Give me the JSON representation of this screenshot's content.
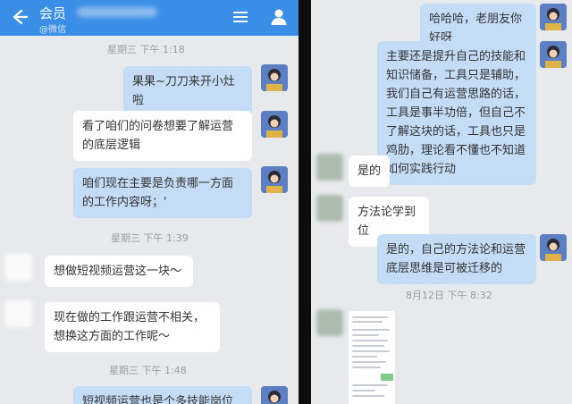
{
  "left": {
    "header": {
      "title": "会员",
      "subtitle": "@微信"
    },
    "messages": [
      {
        "timestamp": "星期三  下午 1:18"
      },
      {
        "text": "果果~刀刀来开小灶啦"
      },
      {
        "text": "看了咱们的问卷想要了解运营的底层逻辑"
      },
      {
        "text": "咱们现在主要是负责哪一方面的工作内容呀；'"
      },
      {
        "timestamp": "星期三  下午 1:39"
      },
      {
        "text": "想做短视频运营这一块～"
      },
      {
        "text": "现在做的工作跟运营不相关，想换这方面的工作呢～"
      },
      {
        "timestamp": "星期三  下午 1:48"
      },
      {
        "text": "短视频运营也是个多技能岗位"
      }
    ]
  },
  "right": {
    "messages": [
      {
        "text": "哈哈哈，老朋友你好呀"
      },
      {
        "text": "主要还是提升自己的技能和知识储备，工具只是辅助，我们自己有运营思路的话，工具是事半功倍，但自己不了解这块的话，工具也只是鸡肋，理论看不懂也不知道如何实践行动"
      },
      {
        "text": "是的"
      },
      {
        "text": "方法论学到位"
      },
      {
        "text": "是的，自己的方法论和运营底层思维是可被迁移的"
      },
      {
        "timestamp": "8月12日  下午 8:32"
      }
    ]
  },
  "colors": {
    "header_blue": "#3a8ee6",
    "chat_background": "#e8e9ed",
    "outgoing_bubble": "#c5dcf7",
    "incoming_bubble": "#ffffff"
  }
}
